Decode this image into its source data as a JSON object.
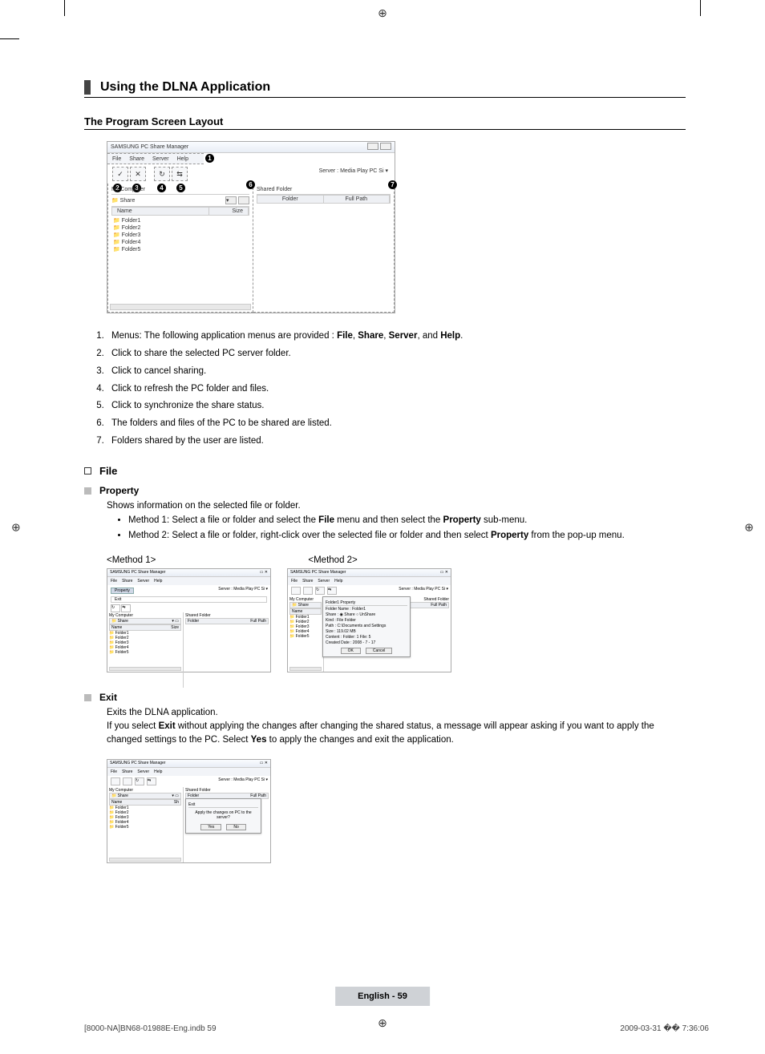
{
  "section_title": "Using the DLNA Application",
  "subsection_title": "The Program Screen Layout",
  "app": {
    "window_title": "SAMSUNG PC Share Manager",
    "menus": [
      "File",
      "Share",
      "Server",
      "Help"
    ],
    "server_label": "Server :",
    "server_value": "Media Play PC Si  ▾",
    "left_header": "My Computer",
    "share_label": "Share",
    "columns_left": [
      "Name",
      "Size"
    ],
    "folders": [
      "Folder1",
      "Folder2",
      "Folder3",
      "Folder4",
      "Folder5"
    ],
    "right_header": "Shared Folder",
    "columns_right": [
      "Folder",
      "Full Path"
    ],
    "badges": [
      "1",
      "2",
      "3",
      "4",
      "5",
      "6",
      "7"
    ]
  },
  "steps": [
    {
      "pre": "Menus: The following application menus are provided : ",
      "bold": [
        "File",
        "Share",
        "Server",
        "Help"
      ],
      "post": "."
    },
    {
      "text": "Click to share the selected PC server folder."
    },
    {
      "text": "Click to cancel sharing."
    },
    {
      "text": "Click to refresh the PC folder and files."
    },
    {
      "text": "Click to synchronize the share status."
    },
    {
      "text": "The folders and files of the PC to be shared are listed."
    },
    {
      "text": "Folders shared by the user are listed."
    }
  ],
  "file_heading": "File",
  "property": {
    "title": "Property",
    "desc": "Shows information on the selected file or folder.",
    "m1_pre": "Method 1: Select a file or folder and select the ",
    "m1_mid": " menu and then select the ",
    "m1_b1": "File",
    "m1_b2": "Property",
    "m1_post": " sub-menu.",
    "m2_pre": "Method 2: Select a file or folder, right-click over the selected file or folder and then select ",
    "m2_b": "Property",
    "m2_post": " from the pop-up menu.",
    "label1": "<Method 1>",
    "label2": "<Method 2>",
    "popup_title": "Folder1 Property",
    "popup_rows": [
      "Folder Name : Folder1",
      "Share :      ◉ Share   ○ UnShare",
      "Kind : File Folder",
      "Path :   C:\\Documents and Settings",
      "Size : 119.02 MB",
      "Content : Folder: 1  File: 5",
      "Created Date : 2008 - 7 - 17"
    ],
    "popup_ok": "OK",
    "popup_cancel": "Cancel"
  },
  "exit": {
    "title": "Exit",
    "p1": "Exits the DLNA application.",
    "p2_pre": "If you select ",
    "p2_b1": "Exit",
    "p2_mid": " without applying the changes after changing the shared status, a message will appear asking if you want to apply the changed settings to the PC. Select ",
    "p2_b2": "Yes",
    "p2_post": " to apply the changes and exit the application.",
    "dialog_title": "Exit",
    "dialog_msg": "Apply the changes on PC to the server?",
    "dialog_yes": "Yes",
    "dialog_no": "No"
  },
  "mini_file_menu": {
    "item1": "Property",
    "item2": "Exit"
  },
  "footer_center": "English - 59",
  "footer_left": "[8000-NA]BN68-01988E-Eng.indb   59",
  "footer_right": "2009-03-31   �� 7:36:06"
}
